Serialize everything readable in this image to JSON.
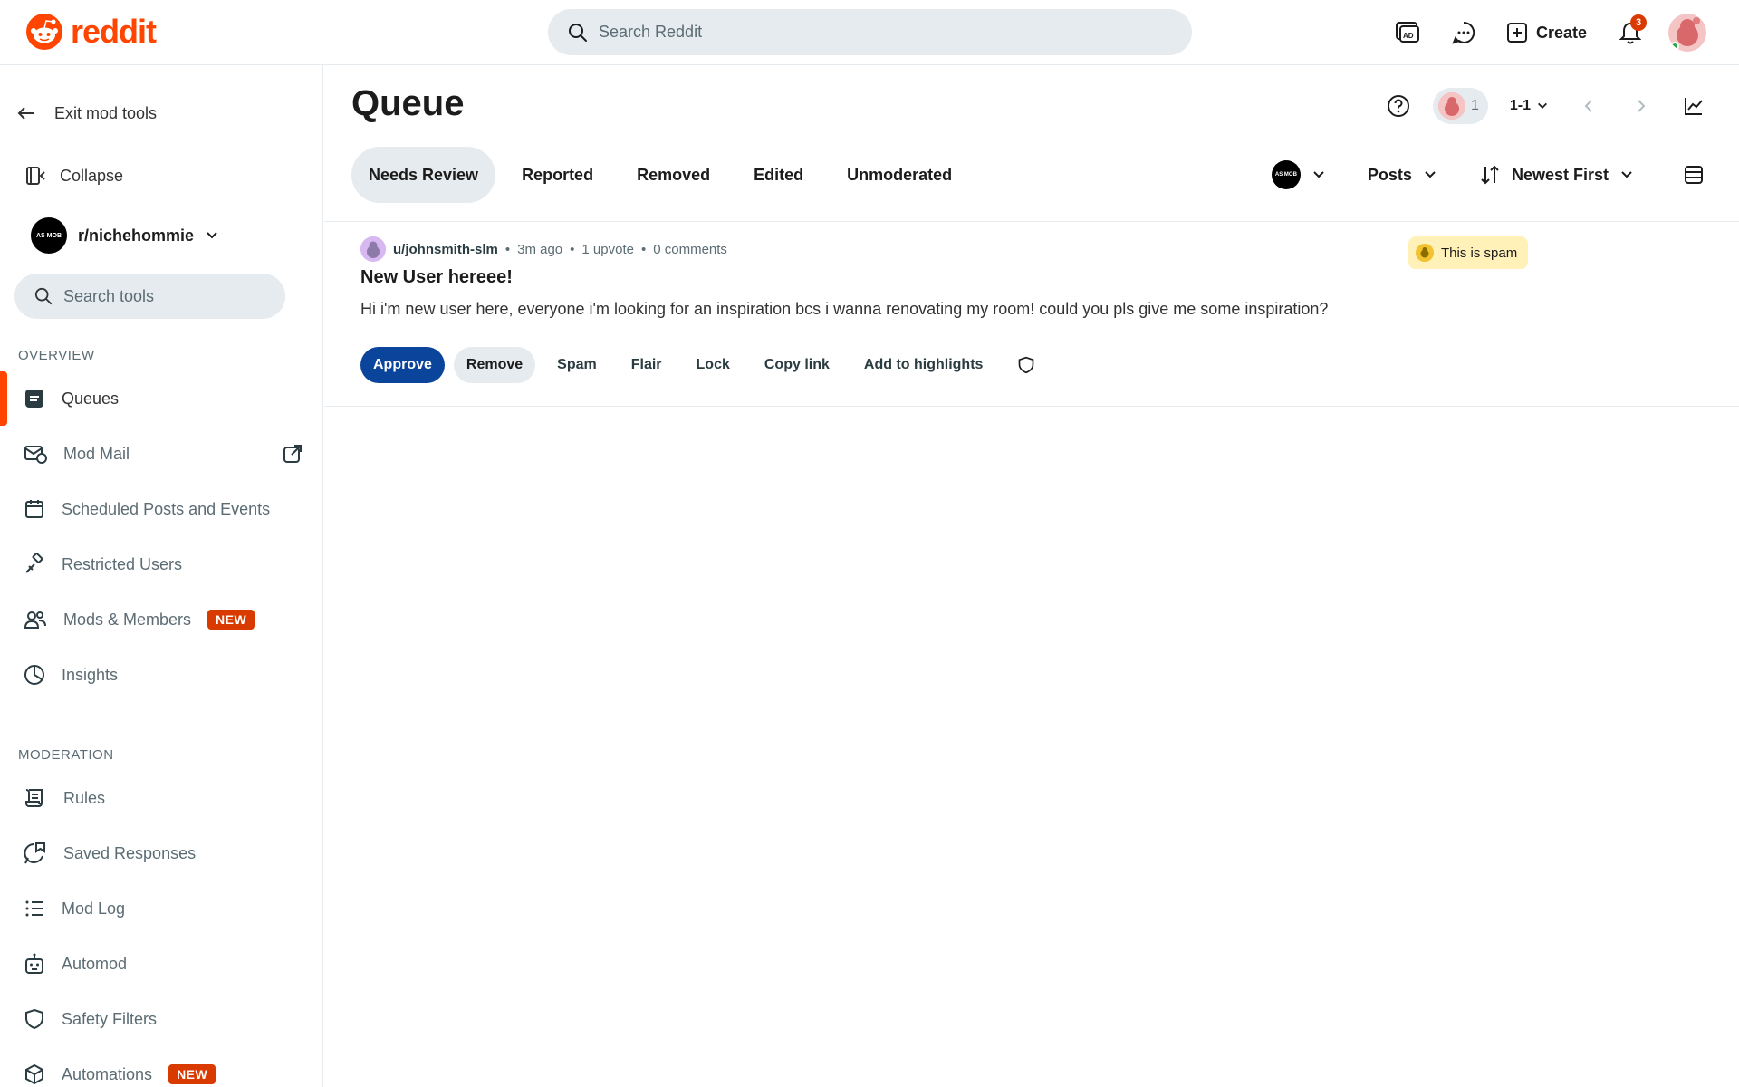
{
  "brand": {
    "name": "reddit",
    "color": "#ff4500"
  },
  "search": {
    "placeholder": "Search Reddit"
  },
  "topbar": {
    "create_label": "Create",
    "notification_count": "3",
    "icons": [
      "advertise-icon",
      "chat-icon",
      "plus-square-icon",
      "bell-icon"
    ]
  },
  "sidebar": {
    "exit_label": "Exit mod tools",
    "collapse_label": "Collapse",
    "subreddit": "r/nichehommie",
    "subreddit_logo_text": "AS MOB",
    "search_placeholder": "Search tools",
    "overview_heading": "OVERVIEW",
    "overview_items": [
      {
        "label": "Queues",
        "icon": "queue-icon"
      },
      {
        "label": "Mod Mail",
        "icon": "mail-icon"
      },
      {
        "label": "Scheduled Posts and Events",
        "icon": "calendar-icon"
      },
      {
        "label": "Restricted Users",
        "icon": "gavel-icon"
      },
      {
        "label": "Mods & Members",
        "icon": "members-icon",
        "tag": "NEW"
      },
      {
        "label": "Insights",
        "icon": "pie-chart-icon"
      }
    ],
    "moderation_heading": "MODERATION",
    "moderation_items": [
      {
        "label": "Rules",
        "icon": "scroll-icon"
      },
      {
        "label": "Saved Responses",
        "icon": "saved-response-icon"
      },
      {
        "label": "Mod Log",
        "icon": "list-icon"
      },
      {
        "label": "Automod",
        "icon": "robot-icon"
      },
      {
        "label": "Safety Filters",
        "icon": "shield-icon"
      },
      {
        "label": "Automations",
        "icon": "cube-icon",
        "tag": "NEW"
      }
    ]
  },
  "main": {
    "title": "Queue",
    "mod_count": "1",
    "range": "1-1",
    "tabs": [
      {
        "label": "Needs Review",
        "active": true
      },
      {
        "label": "Reported"
      },
      {
        "label": "Removed"
      },
      {
        "label": "Edited"
      },
      {
        "label": "Unmoderated"
      }
    ],
    "filters": {
      "type": "Posts",
      "sort": "Newest First"
    }
  },
  "post": {
    "user": "u/johnsmith-slm",
    "time": "3m ago",
    "upvotes": "1 upvote",
    "comments": "0 comments",
    "title": "New User hereee!",
    "body": "Hi i'm new user here, everyone i'm looking for an inspiration bcs i wanna renovating my room! could you pls give me some inspiration?",
    "spam_label": "This is spam",
    "actions": {
      "approve": "Approve",
      "remove": "Remove",
      "spam": "Spam",
      "flair": "Flair",
      "lock": "Lock",
      "copy_link": "Copy link",
      "highlights": "Add to highlights"
    }
  },
  "colors": {
    "approve": "#0a449b",
    "new_tag": "#d93a00",
    "active_bar": "#ff4500",
    "spam_bg": "#fff1b8"
  }
}
